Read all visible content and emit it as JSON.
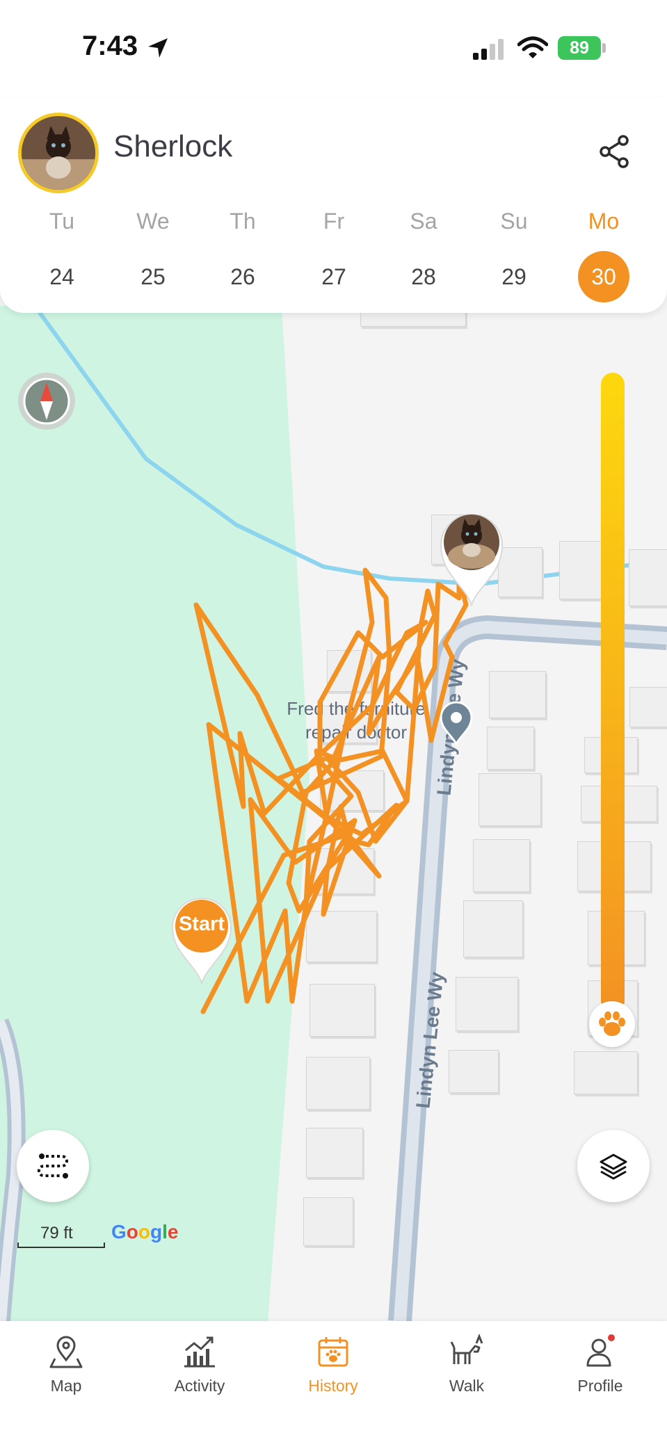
{
  "status_bar": {
    "time": "7:43",
    "battery": "89"
  },
  "header": {
    "pet_name": "Sherlock"
  },
  "week": [
    {
      "label": "Tu",
      "num": "24",
      "active": false
    },
    {
      "label": "We",
      "num": "25",
      "active": false
    },
    {
      "label": "Th",
      "num": "26",
      "active": false
    },
    {
      "label": "Fr",
      "num": "27",
      "active": false
    },
    {
      "label": "Sa",
      "num": "28",
      "active": false
    },
    {
      "label": "Su",
      "num": "29",
      "active": false
    },
    {
      "label": "Mo",
      "num": "30",
      "active": true
    }
  ],
  "map": {
    "poi_line1": "Fred the furniture",
    "poi_line2": "repair doctor",
    "road_name": "Lindyn Lee Wy",
    "start_label": "Start",
    "scale": "79 ft",
    "provider": "Google"
  },
  "nav": {
    "map": "Map",
    "activity": "Activity",
    "history": "History",
    "walk": "Walk",
    "profile": "Profile"
  },
  "colors": {
    "accent": "#f39223",
    "park": "#cff5e2",
    "stream": "#8dd4ef",
    "road": "#b4c3d4"
  }
}
